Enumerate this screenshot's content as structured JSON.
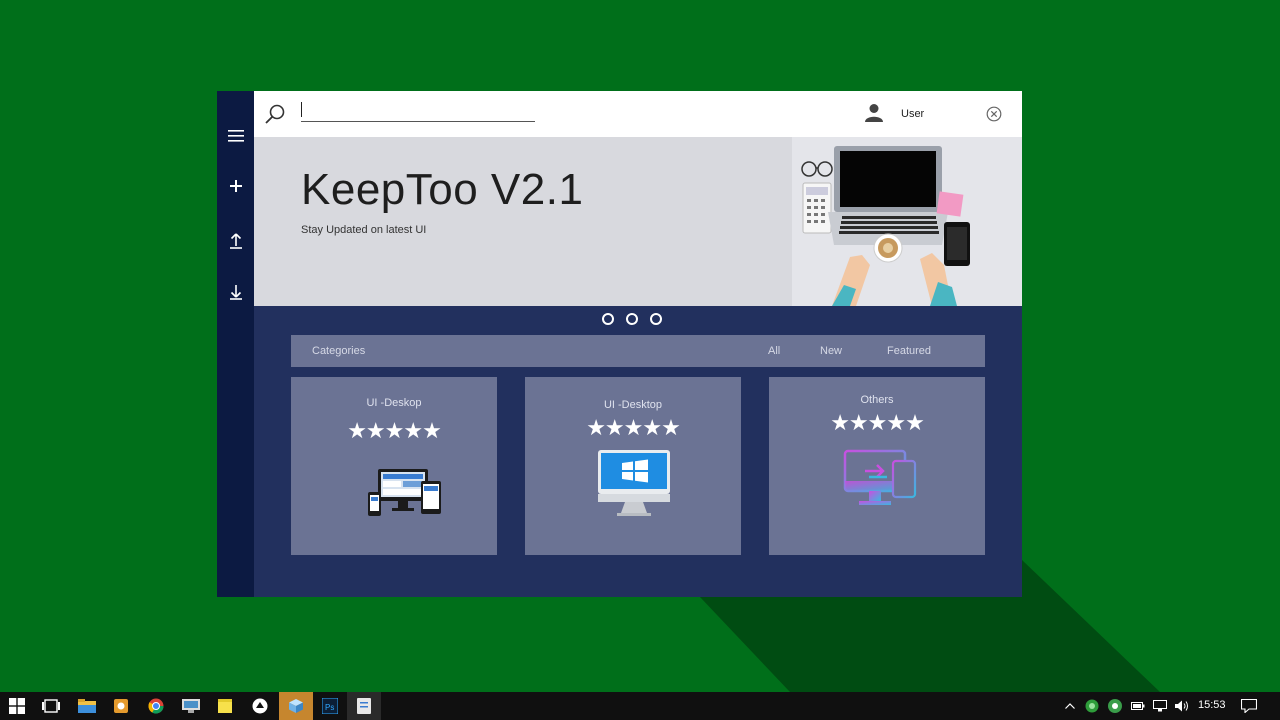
{
  "app": {
    "search": {
      "value": "",
      "placeholder": ""
    },
    "user_label": "User",
    "sidebar": [
      "menu",
      "add",
      "upload",
      "download"
    ]
  },
  "hero": {
    "title": "KeepToo V2.1",
    "subtitle": "Stay Updated on latest UI",
    "slides": 3
  },
  "categories": {
    "label": "Categories",
    "tabs": [
      "All",
      "New",
      "Featured"
    ]
  },
  "cards": [
    {
      "title": "UI -Deskop",
      "stars": "★★★★★",
      "rating": 5,
      "icon": "responsive-devices-icon"
    },
    {
      "title": "UI -Desktop",
      "stars": "★★★★★",
      "rating": 5,
      "icon": "windows-monitor-icon"
    },
    {
      "title": "Others",
      "stars": "★★★★★",
      "rating": 5,
      "icon": "cross-device-icon"
    }
  ],
  "taskbar": {
    "time": "15:53",
    "apps": [
      "start",
      "task-view",
      "file-explorer",
      "app",
      "chrome",
      "app",
      "sticky-notes",
      "app",
      "3d-app",
      "photoshop",
      "app"
    ]
  },
  "colors": {
    "desktop": "#006f1a",
    "sidebar": "#0c1a42",
    "content": "#22305e",
    "card": "#6b7394",
    "taskbar_active": "#c6862e"
  }
}
